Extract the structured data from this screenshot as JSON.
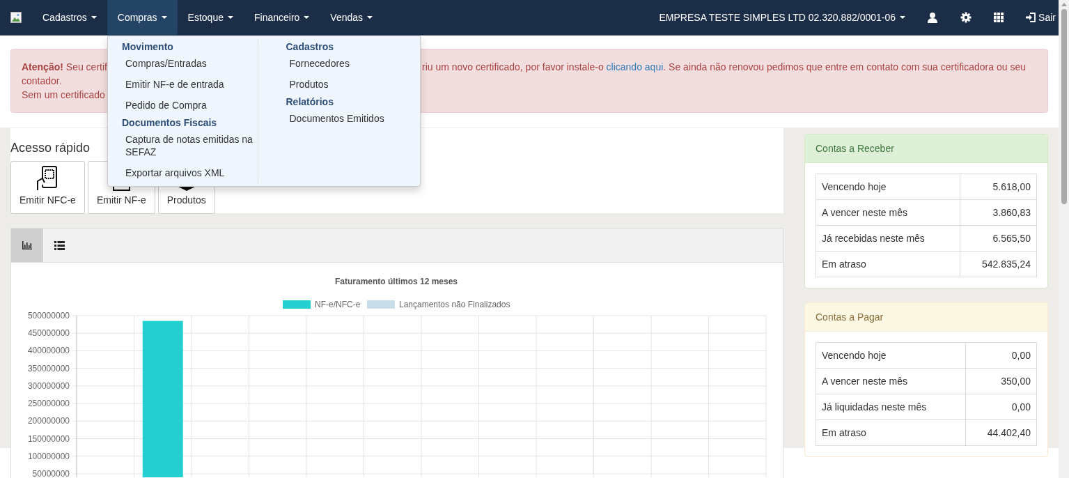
{
  "navbar": {
    "menus": [
      {
        "label": "Cadastros",
        "selected": false
      },
      {
        "label": "Compras",
        "selected": true
      },
      {
        "label": "Estoque",
        "selected": false
      },
      {
        "label": "Financeiro",
        "selected": false
      },
      {
        "label": "Vendas",
        "selected": false
      }
    ],
    "company": "EMPRESA TESTE SIMPLES LTD 02.320.882/0001-06",
    "logout": "Sair"
  },
  "dropdown": {
    "columns": [
      {
        "sections": [
          {
            "title": "Movimento",
            "items": [
              "Compras/Entradas",
              "Emitir NF-e de entrada",
              "Pedido de Compra"
            ]
          },
          {
            "title": "Documentos Fiscais",
            "items": [
              "Captura de notas emitidas na SEFAZ",
              "Exportar arquivos XML"
            ]
          }
        ]
      },
      {
        "sections": [
          {
            "title": "Cadastros",
            "items": [
              "Fornecedores",
              "Produtos"
            ]
          },
          {
            "title": "Relatórios",
            "items": [
              "Documentos Emitidos"
            ]
          }
        ]
      }
    ]
  },
  "alert": {
    "left_lines": [
      "**Atenção!** Seu certif",
      "contador.",
      "Sem um certificado"
    ],
    "right_before": "riu um novo certificado, por favor instale-o",
    "link": "clicando aqui",
    "right_after": ". Se ainda não renovou pedimos que entre em contato com sua certificadora ou seu"
  },
  "quick_access": {
    "title": "Acesso rápido",
    "shortcuts": [
      {
        "label": "Emitir NFC-e",
        "kind": "phone"
      },
      {
        "label": "Emitir NF-e",
        "kind": "document"
      },
      {
        "label": "Produtos",
        "kind": "box"
      }
    ]
  },
  "view_tabs": [
    {
      "kind": "chart",
      "selected": true
    },
    {
      "kind": "list",
      "selected": false
    }
  ],
  "chart": {
    "chart_data": {
      "type": "bar",
      "title": "Faturamento últimos 12 meses",
      "series": [
        {
          "name": "NF-e/NFC-e",
          "color": "#24cfd0",
          "values": [
            null,
            485000000,
            null,
            null,
            null,
            null,
            null,
            null,
            null,
            null,
            null,
            null
          ]
        },
        {
          "name": "Lançamentos não Finalizados",
          "color": "#c9dde8",
          "values": [
            null,
            null,
            null,
            null,
            null,
            null,
            null,
            null,
            null,
            null,
            null,
            null
          ]
        }
      ],
      "grid": true,
      "ylim": [
        40000000,
        500000000
      ],
      "yticks": [
        50000000,
        100000000,
        150000000,
        200000000,
        250000000,
        300000000,
        350000000,
        400000000,
        450000000,
        500000000
      ]
    }
  },
  "receivable": {
    "title": "Contas a Receber",
    "kind": "success",
    "rows": [
      {
        "label": "Vencendo hoje",
        "value": "5.618,00"
      },
      {
        "label": "A vencer neste mês",
        "value": "3.860,83"
      },
      {
        "label": "Já recebidas neste mês",
        "value": "6.565,50"
      },
      {
        "label": "Em atraso",
        "value": "542.835,24"
      }
    ]
  },
  "payable": {
    "title": "Contas a Pagar",
    "kind": "warning",
    "rows": [
      {
        "label": "Vencendo hoje",
        "value": "0,00"
      },
      {
        "label": "A vencer neste mês",
        "value": "350,00"
      },
      {
        "label": "Já liquidadas neste mês",
        "value": "0,00"
      },
      {
        "label": "Em atraso",
        "value": "44.402,40"
      }
    ]
  }
}
